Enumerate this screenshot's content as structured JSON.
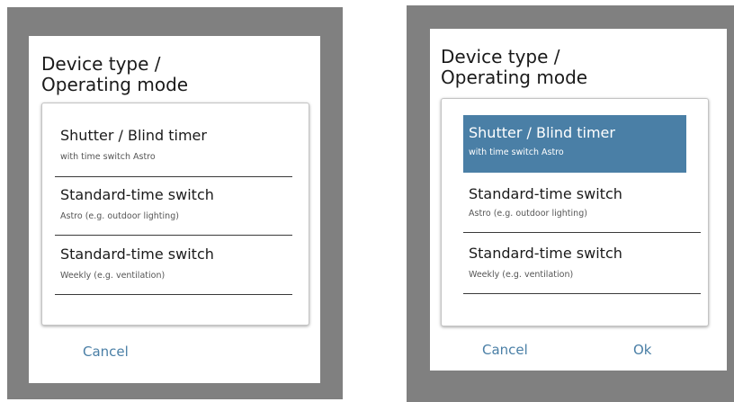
{
  "dialogs": [
    {
      "title": "Device type /\nOperating mode",
      "items": [
        {
          "label": "Shutter / Blind timer",
          "sublabel": "with time switch Astro"
        },
        {
          "label": "Standard-time switch",
          "sublabel": "Astro (e.g. outdoor lighting)"
        },
        {
          "label": "Standard-time switch",
          "sublabel": "Weekly (e.g. ventilation)"
        }
      ],
      "cancel_label": "Cancel"
    },
    {
      "title": "Device type /\nOperating mode",
      "items": [
        {
          "label": "Shutter / Blind timer",
          "sublabel": "with time switch Astro",
          "selected": true
        },
        {
          "label": "Standard-time switch",
          "sublabel": "Astro (e.g. outdoor lighting)"
        },
        {
          "label": "Standard-time switch",
          "sublabel": "Weekly (e.g. ventilation)"
        }
      ],
      "cancel_label": "Cancel",
      "ok_label": "Ok"
    }
  ]
}
